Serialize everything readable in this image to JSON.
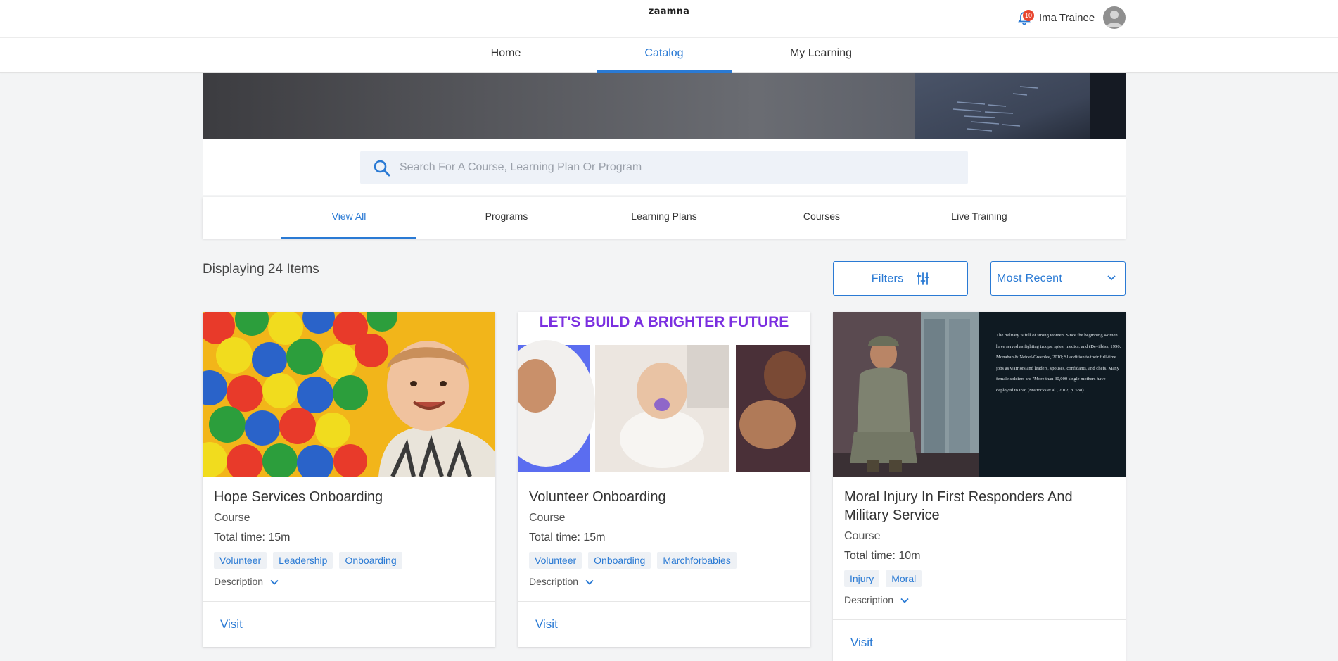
{
  "header": {
    "logo": "zaamna",
    "notification_count": "10",
    "user_name": "Ima Trainee"
  },
  "nav": {
    "items": [
      {
        "label": "Home"
      },
      {
        "label": "Catalog"
      },
      {
        "label": "My Learning"
      }
    ],
    "active": "Catalog"
  },
  "search": {
    "placeholder": "Search For A Course, Learning Plan Or Program",
    "value": ""
  },
  "tabs": {
    "items": [
      {
        "label": "View All"
      },
      {
        "label": "Programs"
      },
      {
        "label": "Learning Plans"
      },
      {
        "label": "Courses"
      },
      {
        "label": "Live Training"
      }
    ],
    "active": "View All"
  },
  "toolbar": {
    "count_text": "Displaying 24 Items",
    "filters_label": "Filters",
    "sort_label": "Most Recent"
  },
  "cards": [
    {
      "title": "Hope Services Onboarding",
      "type": "Course",
      "time": "Total time: 15m",
      "tags": [
        "Volunteer",
        "Leadership",
        "Onboarding"
      ],
      "description_label": "Description",
      "visit_label": "Visit"
    },
    {
      "title": "Volunteer Onboarding",
      "type": "Course",
      "time": "Total time: 15m",
      "tags": [
        "Volunteer",
        "Onboarding",
        "Marchforbabies"
      ],
      "description_label": "Description",
      "visit_label": "Visit",
      "image_banner": "LET'S BUILD A BRIGHTER FUTURE"
    },
    {
      "title": "Moral Injury In First Responders And Military Service",
      "type": "Course",
      "time": "Total time: 10m",
      "tags": [
        "Injury",
        "Moral"
      ],
      "description_label": "Description",
      "visit_label": "Visit",
      "image_text": "The military is full of strong women. Since the beginning women have served as fighting troops, spies, medics, and (Devilbiss, 1990; Monahan & Neidel-Greenlee, 2010; Sl addition to their full-time jobs as warriors and leaders, spouses, confidants, and chefs. Many female soldiers are \"More than 30,000 single mothers have deployed to Iraq (Mattocks et al., 2012, p. 538)."
    }
  ],
  "colors": {
    "accent": "#2a7ad4",
    "badge": "#e8452f",
    "banner_purple": "#7b2fe0"
  }
}
